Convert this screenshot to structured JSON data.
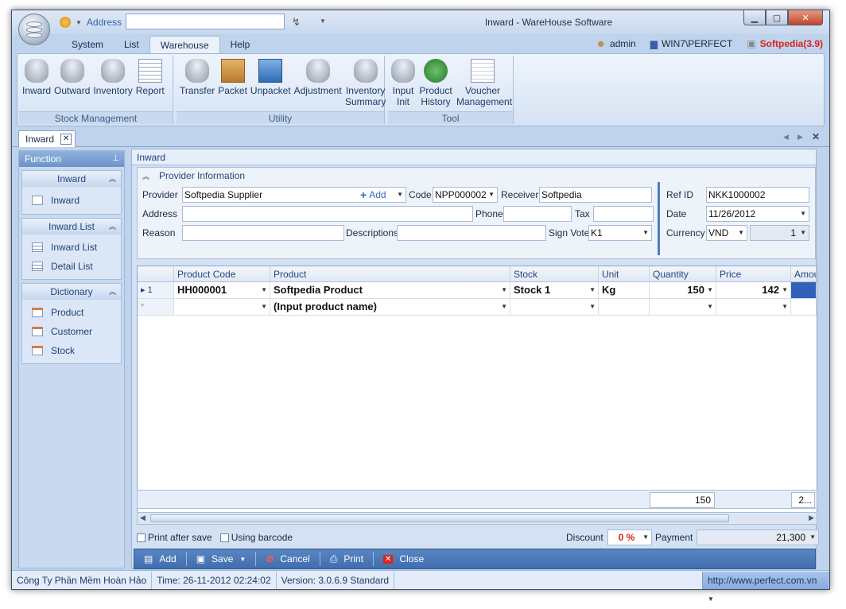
{
  "window": {
    "title": "Inward - WareHouse Software",
    "address_label": "Address"
  },
  "menu": {
    "tabs": [
      "System",
      "List",
      "Warehouse",
      "Help"
    ],
    "active": "Warehouse"
  },
  "userbar": {
    "user": "admin",
    "machine": "WIN7\\PERFECT",
    "db": "Softpedia(3.9)"
  },
  "ribbon": {
    "stock_management": {
      "label": "Stock Management",
      "buttons": [
        "Inward",
        "Outward",
        "Inventory",
        "Report"
      ]
    },
    "utility": {
      "label": "Utility",
      "buttons": [
        "Transfer",
        "Packet",
        "Unpacket",
        "Adjustment",
        "Inventory Summary"
      ]
    },
    "tool": {
      "label": "Tool",
      "buttons": [
        "Input Init",
        "Product History",
        "Voucher Management"
      ]
    }
  },
  "doc_tab": "Inward",
  "sidebar": {
    "header": "Function",
    "sections": [
      {
        "title": "Inward",
        "items": [
          "Inward"
        ]
      },
      {
        "title": "Inward List",
        "items": [
          "Inward List",
          "Detail List"
        ]
      },
      {
        "title": "Dictionary",
        "items": [
          "Product",
          "Customer",
          "Stock"
        ]
      }
    ]
  },
  "main": {
    "header": "Inward"
  },
  "provider": {
    "section_title": "Provider Information",
    "provider_label": "Provider",
    "provider_value": "Softpedia Supplier",
    "add_label": "Add",
    "code_label": "Code",
    "code_value": "NPP000002",
    "receiver_label": "Receiver",
    "receiver_value": "Softpedia",
    "address_label": "Address",
    "address_value": "",
    "phone_label": "Phone",
    "phone_value": "",
    "tax_label": "Tax",
    "tax_value": "",
    "reason_label": "Reason",
    "reason_value": "",
    "descriptions_label": "Descriptions",
    "descriptions_value": "",
    "signvote_label": "Sign Vote",
    "signvote_value": "K1",
    "refid_label": "Ref ID",
    "refid_value": "NKK1000002",
    "date_label": "Date",
    "date_value": "11/26/2012",
    "currency_label": "Currency",
    "currency_value": "VND",
    "rate_value": "1"
  },
  "grid": {
    "columns": [
      "Product Code",
      "Product",
      "Stock",
      "Unit",
      "Quantity",
      "Price",
      "Amou"
    ],
    "rows": [
      {
        "indicator": "1",
        "code": "HH000001",
        "product": "Softpedia Product",
        "stock": "Stock 1",
        "unit": "Kg",
        "quantity": "150",
        "price": "142"
      },
      {
        "indicator": "*",
        "code": "",
        "product": "(Input product name)",
        "stock": "",
        "unit": "",
        "quantity": "",
        "price": ""
      }
    ],
    "total_quantity": "150",
    "total_amount": "2..."
  },
  "options": {
    "print_after_save": "Print after save",
    "using_barcode": "Using barcode",
    "discount_label": "Discount",
    "discount_value": "0 %",
    "payment_label": "Payment",
    "payment_value": "21,300"
  },
  "actions": {
    "add": "Add",
    "save": "Save",
    "cancel": "Cancel",
    "print": "Print",
    "close": "Close"
  },
  "status": {
    "company": "Công Ty Phần Mềm Hoàn Hảo",
    "time": "Time: 26-11-2012 02:24:02",
    "version": "Version: 3.0.6.9 Standard",
    "url": "http://www.perfect.com.vn"
  }
}
